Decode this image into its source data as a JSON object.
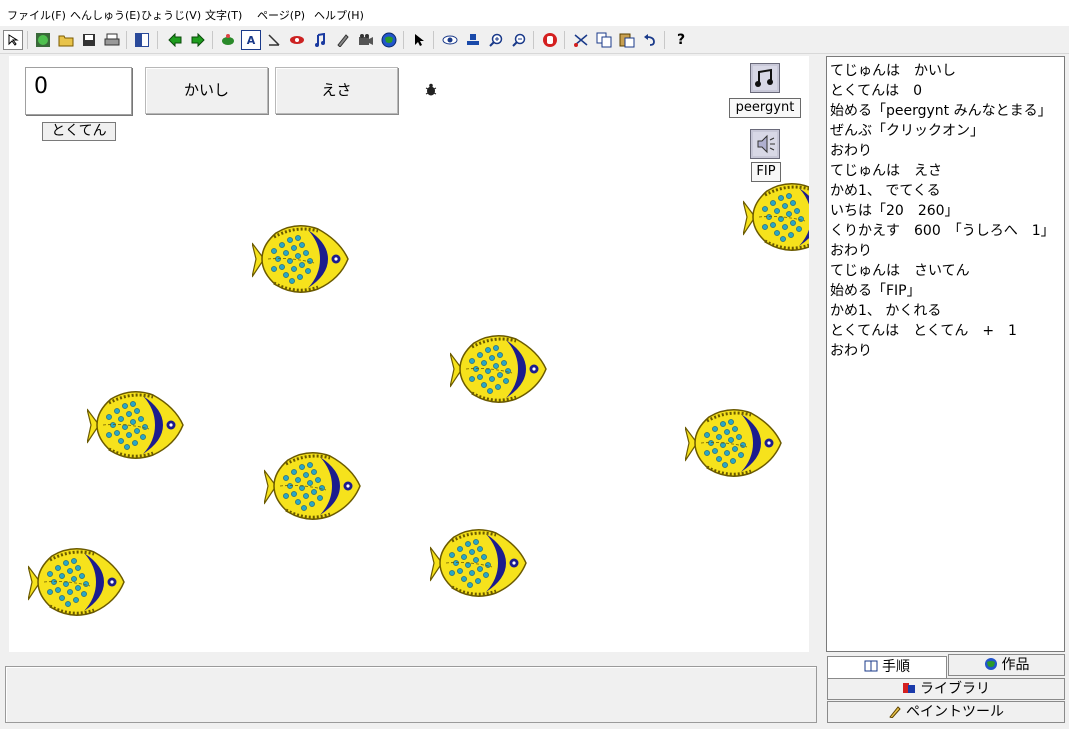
{
  "menu": [
    "ファイル(F)",
    "へんしゅう(E)",
    "ひょうじ(V)",
    "文字(T)",
    "ページ(P)",
    "ヘルプ(H)"
  ],
  "toolbar": {
    "icons": [
      "cursor-mode-icon",
      "new-icon",
      "open-folder-icon",
      "save-icon",
      "print-icon",
      "layout-icon",
      "back-arrow-icon",
      "forward-arrow-icon",
      "turtle-icon",
      "text-tool-icon",
      "shape-tool-icon",
      "eye-tool-icon",
      "music-note-icon",
      "paint-icon",
      "video-icon",
      "globe-icon",
      "arrow-pointer-icon",
      "view-eye-icon",
      "stamp-icon",
      "zoom-in-icon",
      "zoom-out-icon",
      "stop-hand-icon",
      "cut-icon",
      "copy-icon",
      "paste-icon",
      "undo-icon",
      "help-icon"
    ],
    "help_label": "?",
    "text_label": "A"
  },
  "stage": {
    "score_value": "0",
    "score_label": "とくてん",
    "start_button": "かいし",
    "feed_button": "えさ",
    "music_label": "peergynt",
    "sound_label": "FIP"
  },
  "script_lines": [
    "てじゅんは　かいし",
    "とくてんは　0",
    "始める「peergynt みんなとまる」",
    "ぜんぶ「クリックオン」",
    "おわり",
    "てじゅんは　えさ",
    "かめ1、 でてくる",
    "いちは「20　260」",
    "くりかえす　600　「うしろへ　1」",
    "おわり",
    "てじゅんは　さいてん",
    "始める「FIP」",
    "かめ1、 かくれる",
    "とくてんは　とくてん　+　1",
    "おわり"
  ],
  "side_tabs": {
    "procedure": "手順",
    "works": "作品",
    "library": "ライブラリ",
    "paint_tool": "ペイントツール"
  },
  "colors": {
    "fish_body": "#f6e21c",
    "fish_stripe": "#1c1c8e",
    "fish_spots": "#2aa7c4"
  }
}
